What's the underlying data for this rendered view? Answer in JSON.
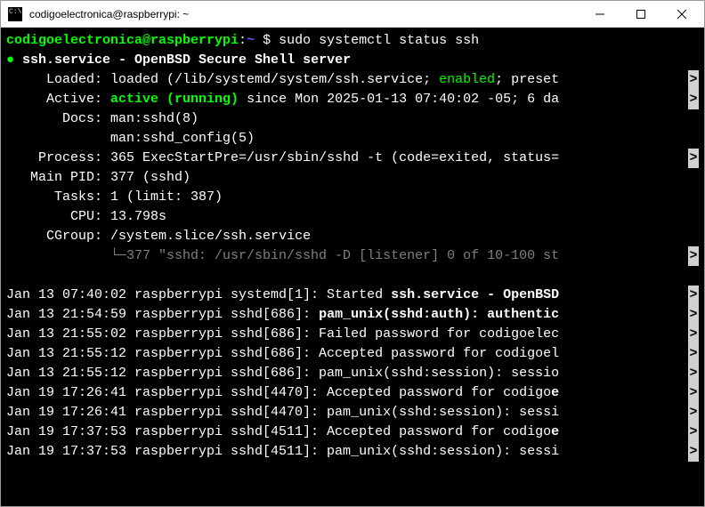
{
  "window": {
    "title": "codigoelectronica@raspberrypi: ~"
  },
  "prompt": {
    "user_host": "codigoelectronica@raspberrypi",
    "colon": ":",
    "path": "~",
    "sigil": " $ ",
    "command": "sudo systemctl status ssh"
  },
  "status": {
    "service_line": "ssh.service - OpenBSD Secure Shell server",
    "loaded_label": "     Loaded:",
    "loaded_pre": " loaded (/lib/systemd/system/ssh.service; ",
    "loaded_enabled": "enabled",
    "loaded_post": "; preset",
    "active_label": "     Active:",
    "active_state": " active (running)",
    "active_since": " since Mon 2025-01-13 07:40:02 -05; 6 da",
    "docs_label": "       Docs:",
    "docs_1": " man:sshd(8)",
    "docs_2": "             man:sshd_config(5)",
    "process_label": "    Process:",
    "process_val": " 365 ExecStartPre=/usr/sbin/sshd -t (code=exited, status=",
    "mainpid_label": "   Main PID:",
    "mainpid_val": " 377 (sshd)",
    "tasks_label": "      Tasks:",
    "tasks_val": " 1 (limit: 387)",
    "cpu_label": "        CPU:",
    "cpu_val": " 13.798s",
    "cgroup_label": "     CGroup:",
    "cgroup_val": " /system.slice/ssh.service",
    "cgroup_child": "             └─377 \"sshd: /usr/sbin/sshd -D [listener] 0 of 10-100 st"
  },
  "logs": [
    {
      "pre": "Jan 13 07:40:02 raspberrypi systemd[1]: Started ",
      "bold": "ssh.service - OpenBSD"
    },
    {
      "pre": "Jan 13 21:54:59 raspberrypi sshd[686]: ",
      "bold": "pam_unix(sshd:auth): authentic"
    },
    {
      "pre": "Jan 13 21:55:02 raspberrypi sshd[686]: Failed password for codigoelec",
      "bold": ""
    },
    {
      "pre": "Jan 13 21:55:12 raspberrypi sshd[686]: Accepted password for codigoel",
      "bold": ""
    },
    {
      "pre": "Jan 13 21:55:12 raspberrypi sshd[686]: pam_unix(sshd:session): sessio",
      "bold": ""
    },
    {
      "pre": "Jan 19 17:26:41 raspberrypi sshd[4470]: Accepted password for codigo",
      "bold": "e"
    },
    {
      "pre": "Jan 19 17:26:41 raspberrypi sshd[4470]: pam_unix(sshd:session): sessi",
      "bold": ""
    },
    {
      "pre": "Jan 19 17:37:53 raspberrypi sshd[4511]: Accepted password for codigo",
      "bold": "e"
    },
    {
      "pre": "Jan 19 17:37:53 raspberrypi sshd[4511]: pam_unix(sshd:session): sessi",
      "bold": ""
    }
  ],
  "arrow": ">"
}
